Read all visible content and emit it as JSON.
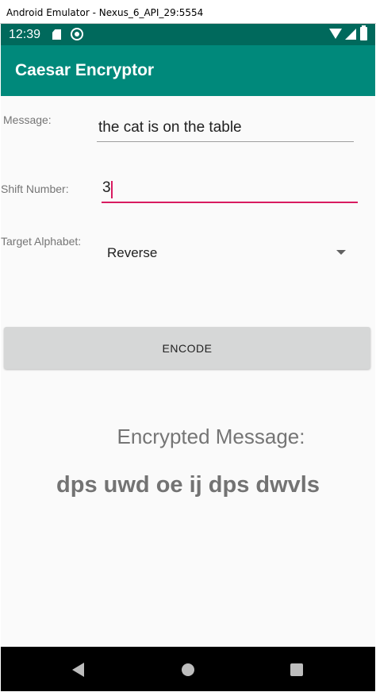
{
  "window": {
    "title": "Android Emulator - Nexus_6_API_29:5554"
  },
  "status_bar": {
    "time": "12:39",
    "icons": [
      "sd-card-icon",
      "sync-icon",
      "wifi-icon",
      "signal-icon",
      "battery-icon"
    ]
  },
  "app_bar": {
    "title": "Caesar Encryptor",
    "color": "#00897b"
  },
  "form": {
    "message_label": "Message:",
    "message_value": "the cat is on the table",
    "shift_label": "Shift Number:",
    "shift_value": "3",
    "target_label": "Target Alphabet:",
    "target_value": "Reverse"
  },
  "encode_button": {
    "label": "ENCODE"
  },
  "result": {
    "heading": "Encrypted Message:",
    "text": "dps uwd oe ij dps dwvls"
  },
  "nav_bar": {
    "icons": [
      "back-icon",
      "home-icon",
      "recents-icon"
    ]
  },
  "colors": {
    "status_bar": "#00695c",
    "app_bar": "#00897b",
    "accent": "#d81b60",
    "background": "#fafafa"
  }
}
